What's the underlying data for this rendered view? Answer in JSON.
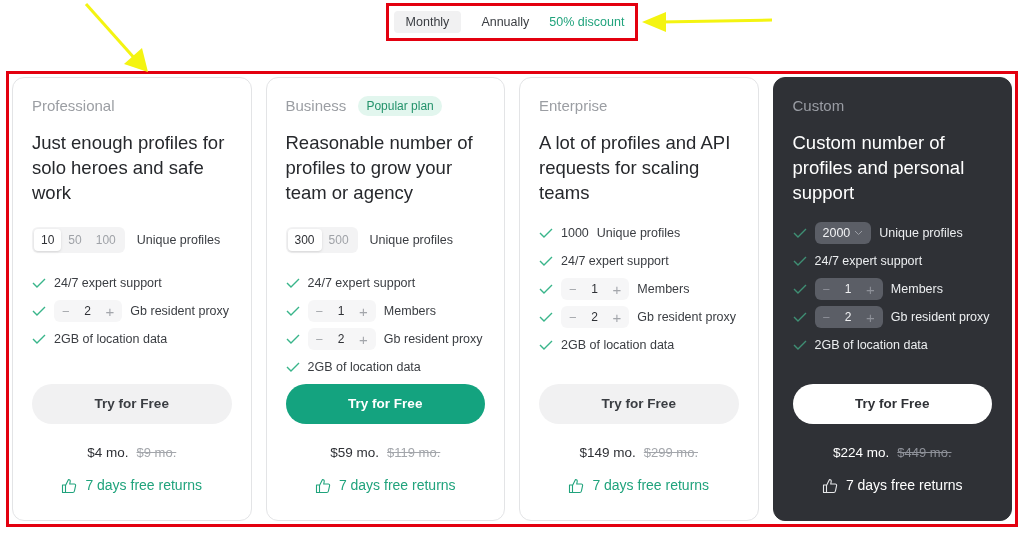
{
  "billing_toggle": {
    "options": [
      {
        "label": "Monthly",
        "selected": true
      },
      {
        "label": "Annually",
        "selected": false
      }
    ],
    "discount": "50% discount"
  },
  "plans": [
    {
      "name": "Professional",
      "dark": false,
      "headline": "Just enough profiles for solo heroes and safe work",
      "profiles": {
        "options": [
          {
            "label": "10",
            "selected": true
          },
          {
            "label": "50",
            "selected": false
          },
          {
            "label": "100",
            "selected": false
          }
        ],
        "label": "Unique profiles"
      },
      "features": [
        {
          "kind": "text",
          "text": "24/7 expert support"
        },
        {
          "kind": "stepper",
          "minus": "−",
          "value": "2",
          "plus": "+",
          "text": "Gb resident proxy"
        },
        {
          "kind": "text",
          "text": "2GB of location data"
        }
      ],
      "button": {
        "label": "Try for Free",
        "primary": false
      },
      "price": "$4 mo.",
      "old_price": "$9 mo.",
      "returns": "7 days free returns"
    },
    {
      "name": "Business",
      "badge": "Popular plan",
      "dark": false,
      "headline": "Reasonable number of profiles to grow your team or agency",
      "profiles": {
        "options": [
          {
            "label": "300",
            "selected": true
          },
          {
            "label": "500",
            "selected": false
          }
        ],
        "label": "Unique profiles"
      },
      "features": [
        {
          "kind": "text",
          "text": "24/7 expert support"
        },
        {
          "kind": "stepper",
          "minus": "−",
          "value": "1",
          "plus": "+",
          "text": "Members"
        },
        {
          "kind": "stepper",
          "minus": "−",
          "value": "2",
          "plus": "+",
          "text": "Gb resident proxy"
        },
        {
          "kind": "text",
          "text": "2GB of location data"
        }
      ],
      "button": {
        "label": "Try for Free",
        "primary": true
      },
      "price": "$59 mo.",
      "old_price": "$119 mo.",
      "returns": "7 days free returns"
    },
    {
      "name": "Enterprise",
      "dark": false,
      "headline": "A lot of profiles and API requests for scaling teams",
      "features": [
        {
          "kind": "count",
          "value": "1000",
          "text": "Unique profiles"
        },
        {
          "kind": "text",
          "text": "24/7 expert support"
        },
        {
          "kind": "stepper",
          "minus": "−",
          "value": "1",
          "plus": "+",
          "text": "Members"
        },
        {
          "kind": "stepper",
          "minus": "−",
          "value": "2",
          "plus": "+",
          "text": "Gb resident proxy"
        },
        {
          "kind": "text",
          "text": "2GB of location data"
        }
      ],
      "button": {
        "label": "Try for Free",
        "primary": false
      },
      "price": "$149 mo.",
      "old_price": "$299 mo.",
      "returns": "7 days free returns"
    },
    {
      "name": "Custom",
      "dark": true,
      "headline": "Custom number of profiles and personal support",
      "features": [
        {
          "kind": "select",
          "value": "2000",
          "text": "Unique profiles"
        },
        {
          "kind": "text",
          "text": "24/7 expert support"
        },
        {
          "kind": "stepper",
          "minus": "−",
          "value": "1",
          "plus": "+",
          "text": "Members"
        },
        {
          "kind": "stepper",
          "minus": "−",
          "value": "2",
          "plus": "+",
          "text": "Gb resident proxy"
        },
        {
          "kind": "text",
          "text": "2GB of location data"
        }
      ],
      "button": {
        "label": "Try for Free",
        "primary": false
      },
      "price": "$224 mo.",
      "old_price": "$449 mo.",
      "returns": "7 days free returns"
    }
  ]
}
